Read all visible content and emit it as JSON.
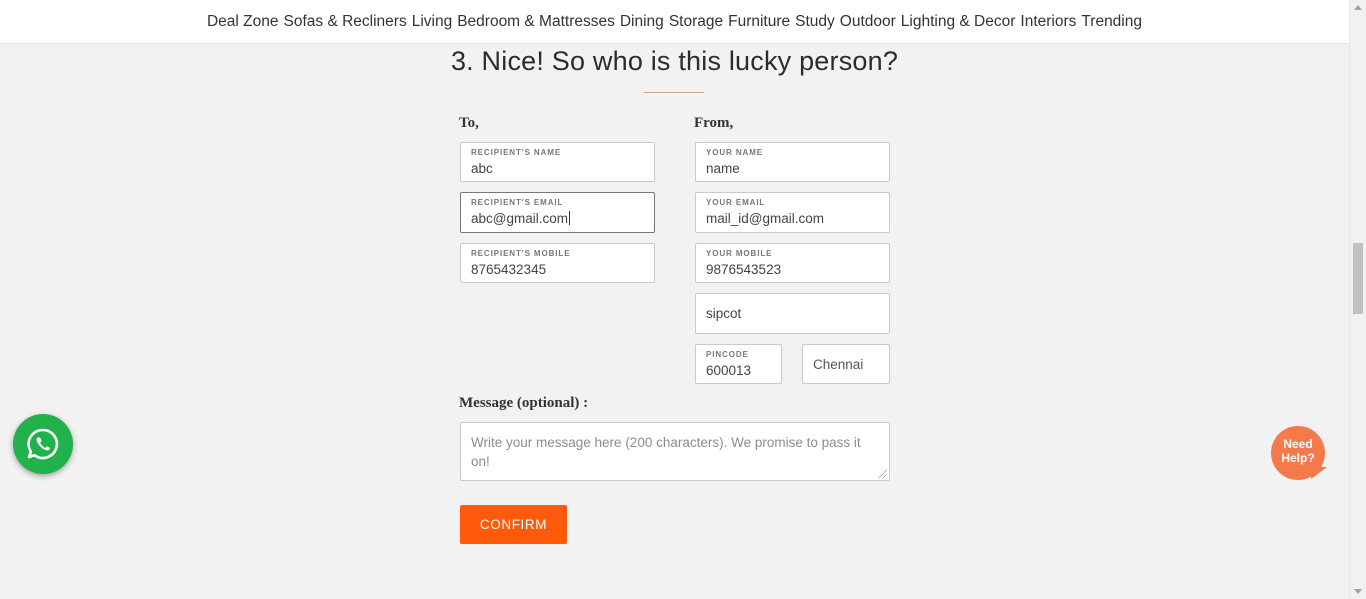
{
  "nav": {
    "items": [
      "Deal Zone",
      "Sofas & Recliners",
      "Living",
      "Bedroom & Mattresses",
      "Dining",
      "Storage",
      "Furniture",
      "Study",
      "Outdoor",
      "Lighting & Decor",
      "Interiors",
      "Trending"
    ]
  },
  "heading": "3. Nice! So who is this lucky person?",
  "to": {
    "label": "To,",
    "name": {
      "label": "RECIPIENT'S NAME",
      "value": "abc"
    },
    "email": {
      "label": "RECIPIENT'S EMAIL",
      "value": "abc@gmail.com"
    },
    "mobile": {
      "label": "RECIPIENT'S MOBILE",
      "value": "8765432345"
    }
  },
  "from": {
    "label": "From,",
    "name": {
      "label": "YOUR NAME",
      "value": "name"
    },
    "email": {
      "label": "YOUR EMAIL",
      "value": "mail_id@gmail.com"
    },
    "mobile": {
      "label": "YOUR MOBILE",
      "value": "9876543523"
    },
    "address": {
      "value": "sipcot"
    },
    "pincode": {
      "label": "PINCODE",
      "value": "600013"
    },
    "city": {
      "value": "Chennai"
    }
  },
  "message": {
    "label": "Message (optional) :",
    "placeholder": "Write your message here (200 characters). We promise to pass it on!"
  },
  "confirm_label": "CONFIRM",
  "help": {
    "line1": "Need",
    "line2": "Help?"
  },
  "colors": {
    "accent": "#ff5a0a",
    "whatsapp": "#22b24c",
    "help": "#f47a4c"
  }
}
